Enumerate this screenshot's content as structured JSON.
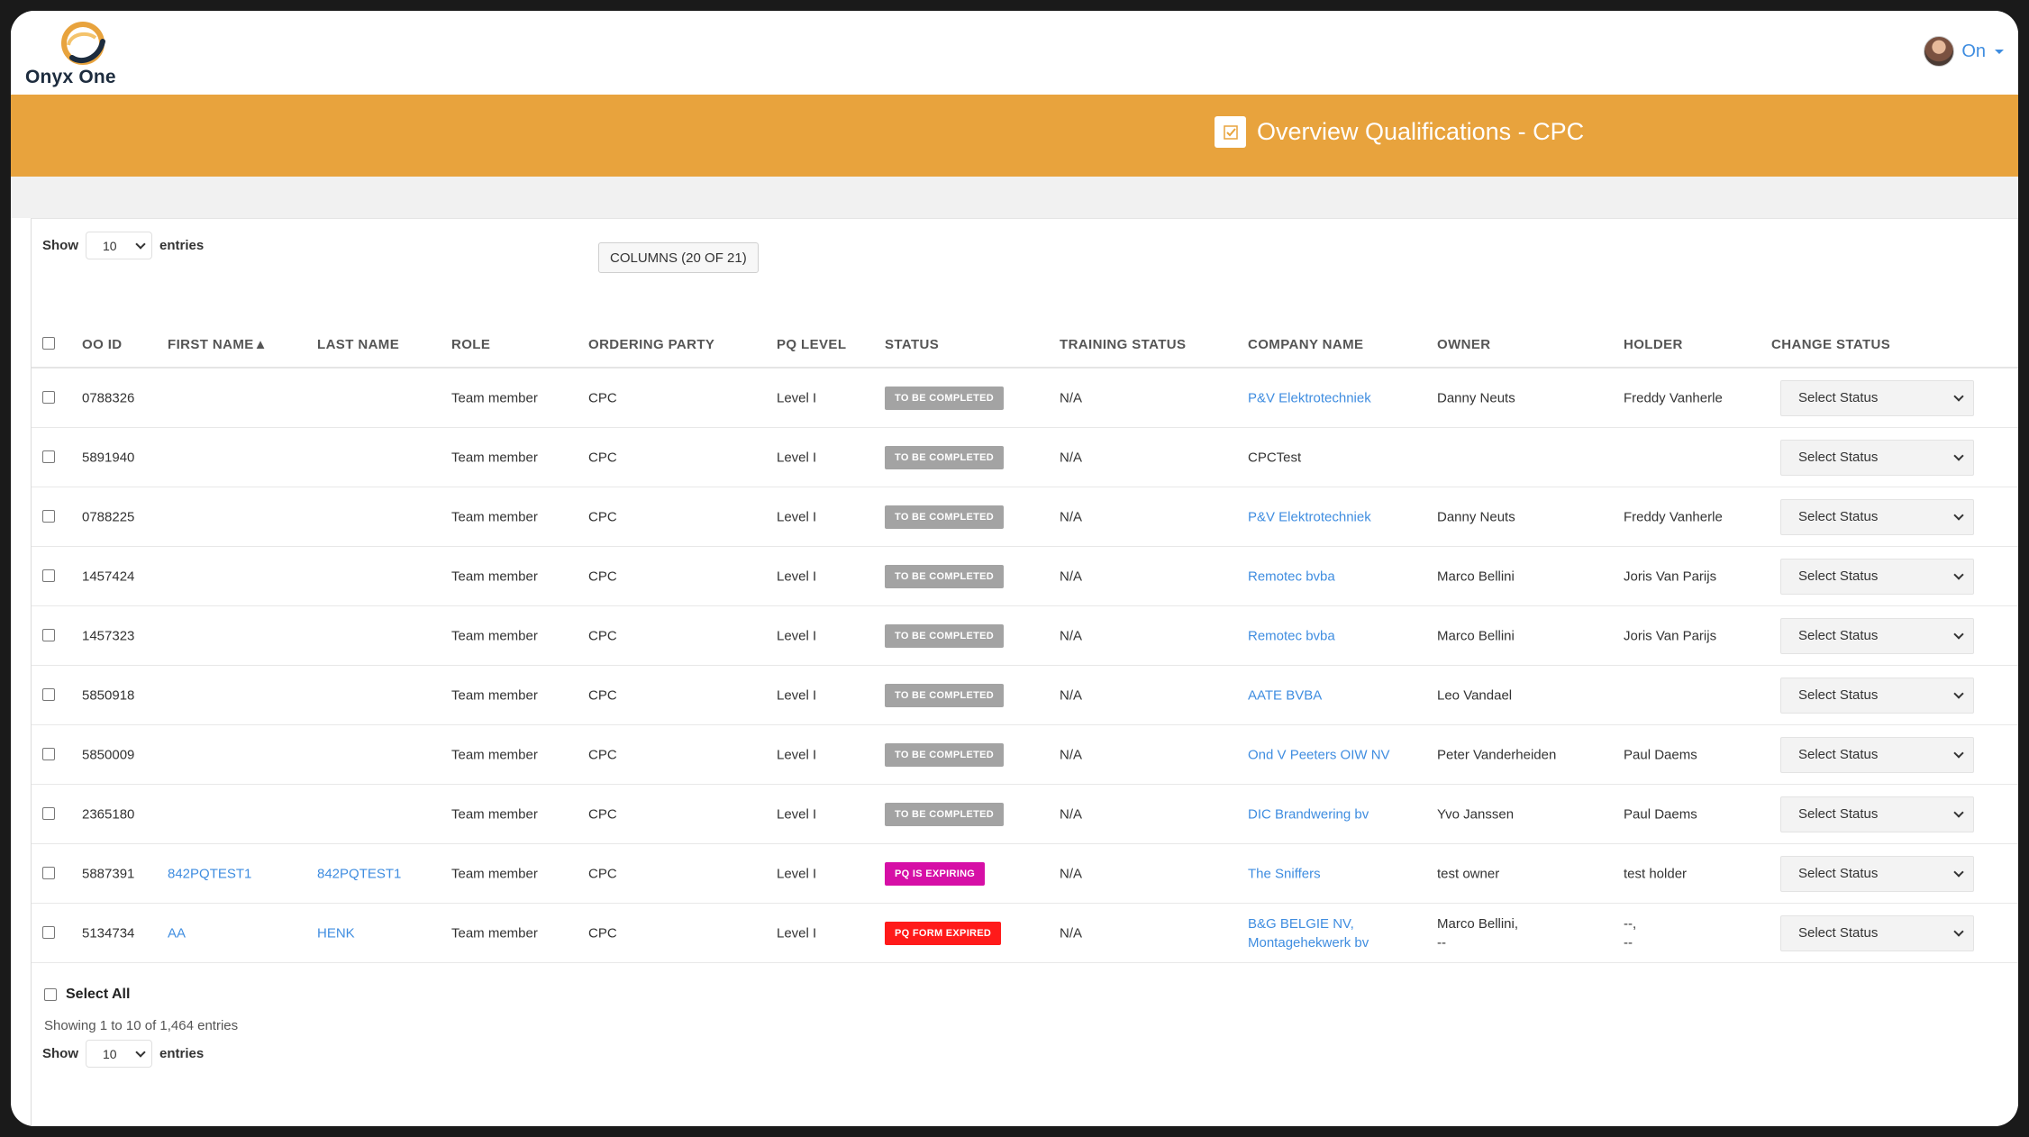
{
  "app": {
    "logo_text": "Onyx One",
    "user_label": "On"
  },
  "banner": {
    "title": "Overview Qualifications - CPC"
  },
  "controls": {
    "show_label": "Show",
    "entries_label": "entries",
    "page_length": "10",
    "columns_button": "COLUMNS (20 OF 21)"
  },
  "table": {
    "columns": [
      "OO ID",
      "FIRST NAME▲",
      "LAST NAME",
      "ROLE",
      "ORDERING PARTY",
      "PQ LEVEL",
      "STATUS",
      "TRAINING STATUS",
      "COMPANY NAME",
      "OWNER",
      "HOLDER",
      "CHANGE STATUS"
    ],
    "select_placeholder": "Select Status",
    "rows": [
      {
        "id": "0788326",
        "first": "",
        "last": "",
        "role": "Team member",
        "party": "CPC",
        "level": "Level I",
        "status": "TO BE COMPLETED",
        "status_kind": "grey",
        "training": "N/A",
        "company": "P&V Elektrotechniek",
        "company_line2": "",
        "company_link": true,
        "owner": "Danny Neuts",
        "owner_line2": "",
        "holder": "Freddy Vanherle",
        "holder_line2": ""
      },
      {
        "id": "5891940",
        "first": "",
        "last": "",
        "role": "Team member",
        "party": "CPC",
        "level": "Level I",
        "status": "TO BE COMPLETED",
        "status_kind": "grey",
        "training": "N/A",
        "company": "CPCTest",
        "company_line2": "",
        "company_link": false,
        "owner": "",
        "owner_line2": "",
        "holder": "",
        "holder_line2": ""
      },
      {
        "id": "0788225",
        "first": "",
        "last": "",
        "role": "Team member",
        "party": "CPC",
        "level": "Level I",
        "status": "TO BE COMPLETED",
        "status_kind": "grey",
        "training": "N/A",
        "company": "P&V Elektrotechniek",
        "company_line2": "",
        "company_link": true,
        "owner": "Danny Neuts",
        "owner_line2": "",
        "holder": "Freddy Vanherle",
        "holder_line2": ""
      },
      {
        "id": "1457424",
        "first": "",
        "last": "",
        "role": "Team member",
        "party": "CPC",
        "level": "Level I",
        "status": "TO BE COMPLETED",
        "status_kind": "grey",
        "training": "N/A",
        "company": "Remotec bvba",
        "company_line2": "",
        "company_link": true,
        "owner": "Marco Bellini",
        "owner_line2": "",
        "holder": "Joris Van Parijs",
        "holder_line2": ""
      },
      {
        "id": "1457323",
        "first": "",
        "last": "",
        "role": "Team member",
        "party": "CPC",
        "level": "Level I",
        "status": "TO BE COMPLETED",
        "status_kind": "grey",
        "training": "N/A",
        "company": "Remotec bvba",
        "company_line2": "",
        "company_link": true,
        "owner": "Marco Bellini",
        "owner_line2": "",
        "holder": "Joris Van Parijs",
        "holder_line2": ""
      },
      {
        "id": "5850918",
        "first": "",
        "last": "",
        "role": "Team member",
        "party": "CPC",
        "level": "Level I",
        "status": "TO BE COMPLETED",
        "status_kind": "grey",
        "training": "N/A",
        "company": "AATE BVBA",
        "company_line2": "",
        "company_link": true,
        "owner": "Leo Vandael",
        "owner_line2": "",
        "holder": "",
        "holder_line2": ""
      },
      {
        "id": "5850009",
        "first": "",
        "last": "",
        "role": "Team member",
        "party": "CPC",
        "level": "Level I",
        "status": "TO BE COMPLETED",
        "status_kind": "grey",
        "training": "N/A",
        "company": "Ond V Peeters OIW NV",
        "company_line2": "",
        "company_link": true,
        "owner": "Peter Vanderheiden",
        "owner_line2": "",
        "holder": "Paul Daems",
        "holder_line2": ""
      },
      {
        "id": "2365180",
        "first": "",
        "last": "",
        "role": "Team member",
        "party": "CPC",
        "level": "Level I",
        "status": "TO BE COMPLETED",
        "status_kind": "grey",
        "training": "N/A",
        "company": "DIC Brandwering bv",
        "company_line2": "",
        "company_link": true,
        "owner": "Yvo Janssen",
        "owner_line2": "",
        "holder": "Paul Daems",
        "holder_line2": ""
      },
      {
        "id": "5887391",
        "first": "842PQTEST1",
        "last": "842PQTEST1",
        "role": "Team member",
        "party": "CPC",
        "level": "Level I",
        "status": "PQ IS EXPIRING",
        "status_kind": "magenta",
        "training": "N/A",
        "company": "The Sniffers",
        "company_line2": "",
        "company_link": true,
        "owner": "test owner",
        "owner_line2": "",
        "holder": "test holder",
        "holder_line2": ""
      },
      {
        "id": "5134734",
        "first": "AA",
        "last": "HENK",
        "role": "Team member",
        "party": "CPC",
        "level": "Level I",
        "status": "PQ FORM EXPIRED",
        "status_kind": "red",
        "training": "N/A",
        "company": "B&G BELGIE NV,",
        "company_line2": "Montagehekwerk bv",
        "company_link": true,
        "owner": "Marco Bellini,",
        "owner_line2": "--",
        "holder": "--,",
        "holder_line2": "--"
      }
    ]
  },
  "footer": {
    "select_all": "Select All",
    "info": "Showing 1 to 10 of 1,464 entries"
  },
  "colors": {
    "banner": "#e8a33d",
    "link": "#3f8de0",
    "grey": "#a3a3a3",
    "magenta": "#d60fa6",
    "red": "#ff1a1a"
  }
}
